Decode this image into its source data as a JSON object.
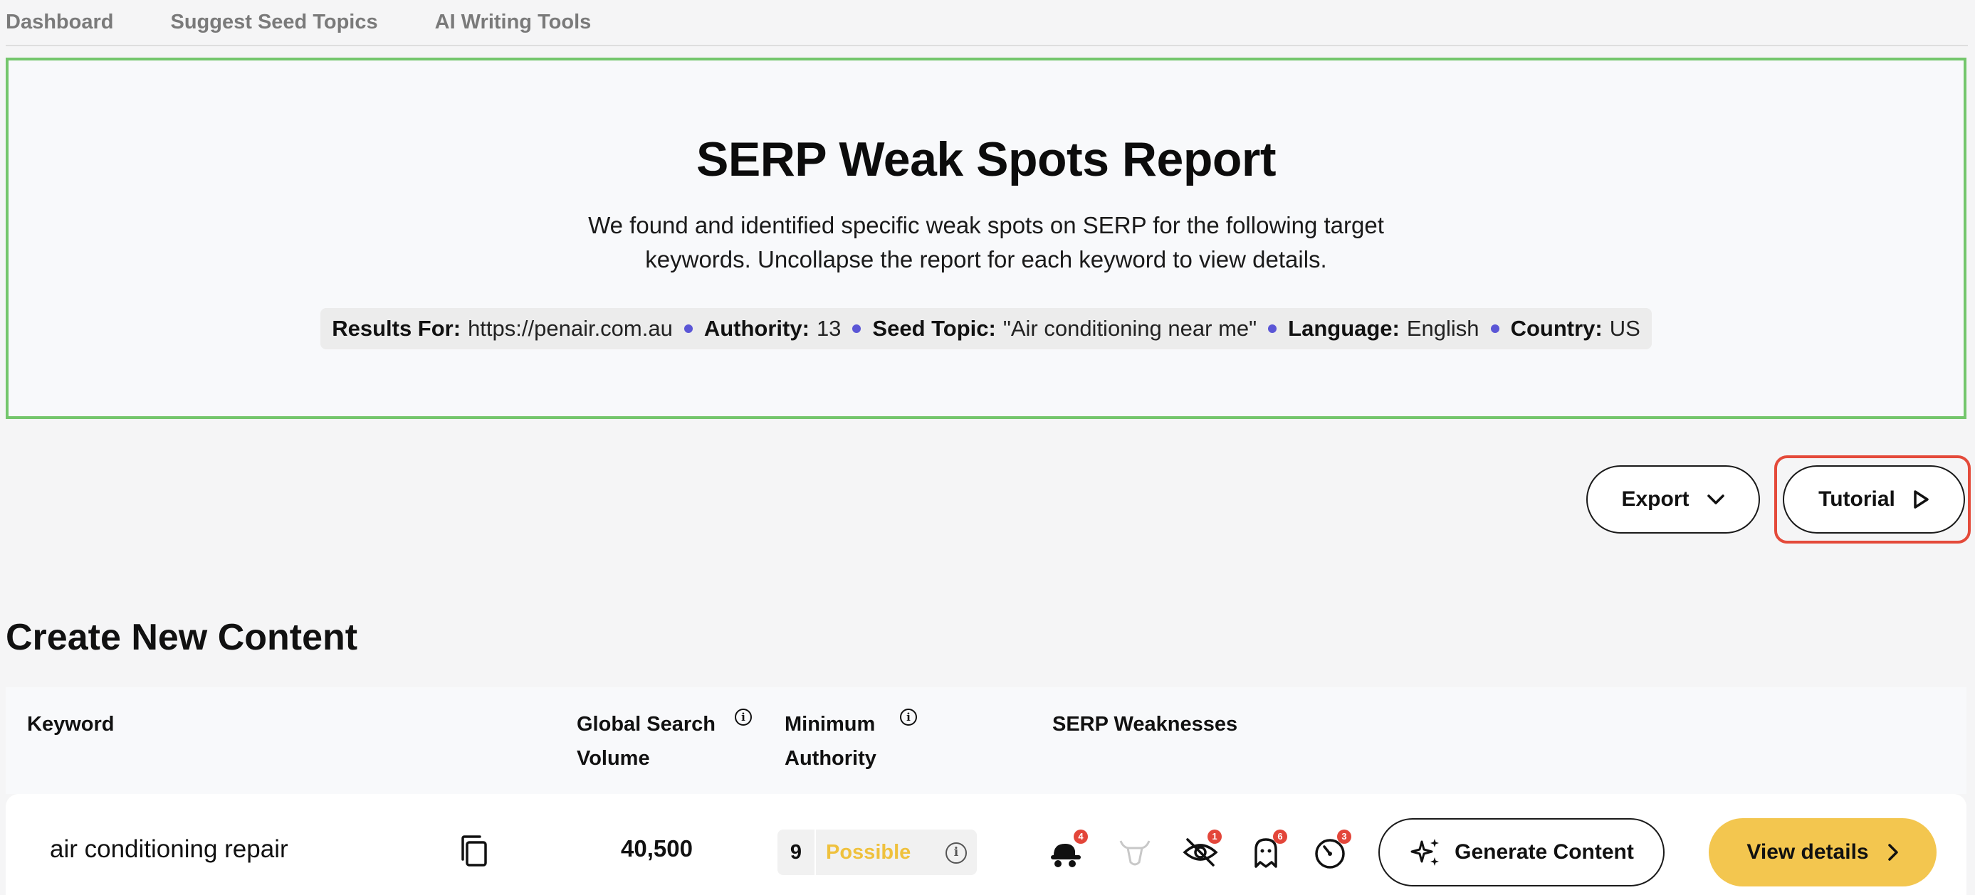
{
  "nav": {
    "items": [
      "Dashboard",
      "Suggest Seed Topics",
      "AI Writing Tools"
    ]
  },
  "report": {
    "title": "SERP Weak Spots Report",
    "description": "We found and identified specific weak spots on SERP for the following target keywords. Uncollapse the report for each keyword to view details.",
    "meta": {
      "results_for_label": "Results For:",
      "results_for_value": "https://penair.com.au",
      "authority_label": "Authority:",
      "authority_value": "13",
      "seed_topic_label": "Seed Topic:",
      "seed_topic_value": "\"Air conditioning near me\"",
      "language_label": "Language:",
      "language_value": "English",
      "country_label": "Country:",
      "country_value": "US"
    }
  },
  "actions": {
    "export_label": "Export",
    "tutorial_label": "Tutorial"
  },
  "section": {
    "title_bold": "Create",
    "title_rest": "New Content"
  },
  "table": {
    "headers": {
      "keyword": "Keyword",
      "volume_line1": "Global Search",
      "volume_line2": "Volume",
      "authority_line1": "Minimum",
      "authority_line2": "Authority",
      "weaknesses": "SERP Weaknesses"
    },
    "rows": [
      {
        "keyword": "air conditioning repair",
        "volume": "40,500",
        "min_authority": "9",
        "status": "Possible",
        "weakness_badges": [
          "4",
          "1",
          "6",
          "3"
        ],
        "generate_label": "Generate Content",
        "view_label": "View details"
      }
    ]
  },
  "colors": {
    "accent_purple": "#5b56d6",
    "hero_border": "#74c66c",
    "tutorial_highlight": "#e44a3a",
    "possible": "#efc13d",
    "view_button": "#f3c64f",
    "badge": "#e3463a"
  }
}
